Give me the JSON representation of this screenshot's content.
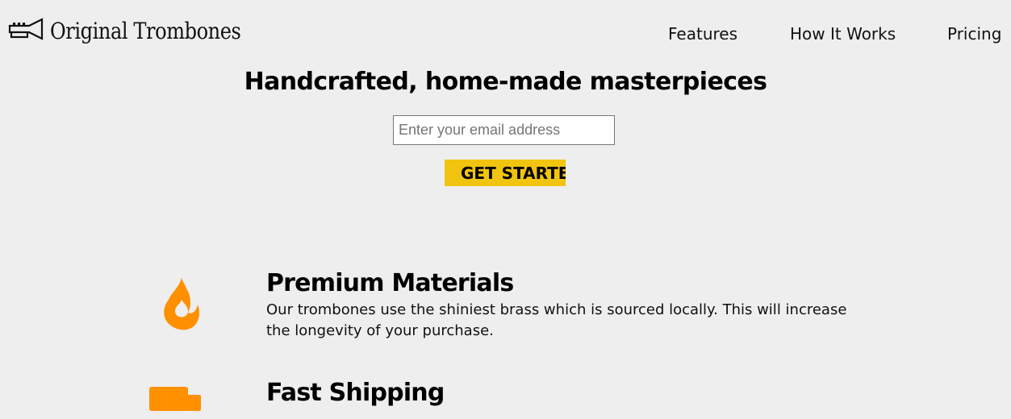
{
  "header": {
    "logo_text": "Original Trombones",
    "nav": {
      "features": "Features",
      "how_it_works": "How It Works",
      "pricing": "Pricing"
    }
  },
  "hero": {
    "title": "Handcrafted, home-made masterpieces",
    "email_placeholder": "Enter your email address",
    "cta_label": "GET STARTED"
  },
  "features": [
    {
      "icon": "fire-icon",
      "title": "Premium Materials",
      "description": "Our trombones use the shiniest brass which is sourced locally. This will increase the longevity of your purchase."
    },
    {
      "icon": "truck-icon",
      "title": "Fast Shipping"
    }
  ],
  "colors": {
    "background": "#eeeeee",
    "accent": "#f1c40f",
    "icon": "#ff9000"
  }
}
